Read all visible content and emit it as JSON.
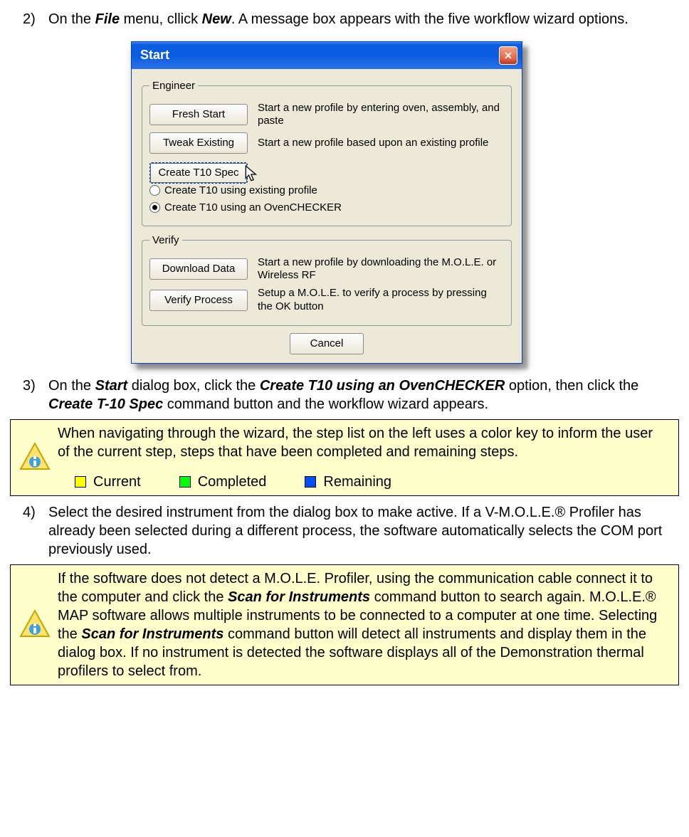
{
  "step2": {
    "num": "2)",
    "pre": "On the ",
    "file": "File",
    "mid": " menu, cllick ",
    "new": "New",
    "post": ". A message box appears with the five workflow wizard options."
  },
  "dialog": {
    "title": "Start",
    "close": "✕",
    "engineer": {
      "legend": "Engineer",
      "fresh": {
        "label": "Fresh Start",
        "desc": "Start a new profile by entering oven, assembly, and paste"
      },
      "tweak": {
        "label": "Tweak Existing",
        "desc": "Start a new profile based upon an existing profile"
      },
      "create": {
        "label": "Create T10 Spec",
        "opt1": "Create T10 using existing profile",
        "opt2": "Create T10 using an OvenCHECKER"
      }
    },
    "verify": {
      "legend": "Verify",
      "download": {
        "label": "Download Data",
        "desc": "Start a new profile by downloading the M.O.L.E. or Wireless RF"
      },
      "verify": {
        "label": "Verify Process",
        "desc": "Setup a M.O.L.E. to verify a process by pressing the OK button"
      }
    },
    "cancel": "Cancel"
  },
  "step3": {
    "num": "3)",
    "pre": "On the ",
    "start": "Start",
    "mid1": " dialog box, click the ",
    "opt": "Create T10 using an OvenCHECKER",
    "mid2": " option, then click the ",
    "btn": "Create T-10 Spec",
    "post": " command button and the workflow wizard appears."
  },
  "note1": {
    "text": "When navigating through the wizard, the step list on the left uses a color key to inform the user of the current step, steps that have been completed and remaining steps.",
    "leg": {
      "current": "Current",
      "completed": "Completed",
      "remaining": "Remaining"
    }
  },
  "step4": {
    "num": "4)",
    "text": "Select the desired instrument from the dialog box to make active. If a V-M.O.L.E.® Profiler has already been selected during a different process, the software automatically selects the COM port previously used."
  },
  "note2": {
    "p1": "If the software does not detect a M.O.L.E. Profiler, using the communication cable connect it to the computer and click the ",
    "b1": "Scan for Instruments",
    "p2": " command button to search again. M.O.L.E.® MAP software allows multiple instruments to be connected to a computer at one time. Selecting the ",
    "b2": "Scan for Instruments",
    "p3": " command button will detect all instruments and display them in the dialog box. If no instrument is detected the software displays all of the Demonstration thermal profilers to select from."
  }
}
